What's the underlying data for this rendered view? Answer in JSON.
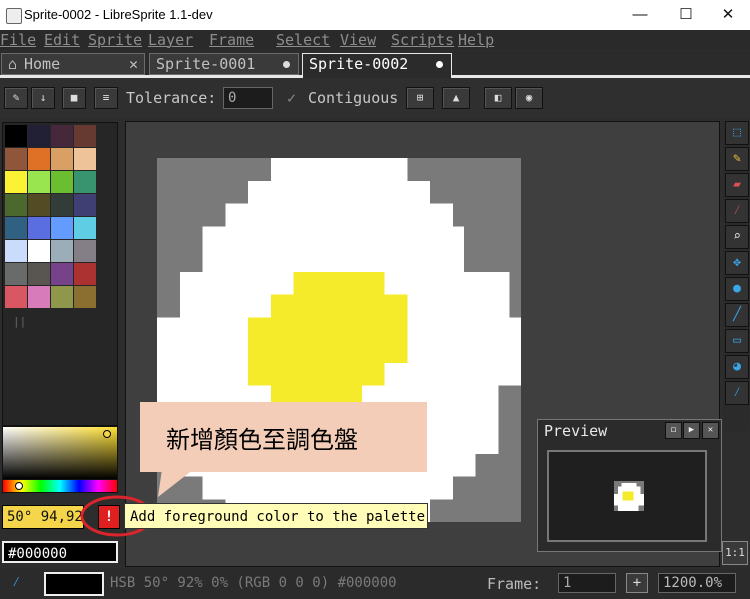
{
  "window": {
    "title": "Sprite-0002 - LibreSprite 1.1-dev",
    "controls": [
      "—",
      "☐",
      "✕"
    ]
  },
  "menu": [
    "File",
    "Edit",
    "Sprite",
    "Layer",
    "Frame",
    "Select",
    "View",
    "Scripts",
    "Help"
  ],
  "tabs": [
    {
      "label": "Home",
      "icon": "home-icon",
      "close": "✕"
    },
    {
      "label": "Sprite-0001"
    },
    {
      "label": "Sprite-0002",
      "active": true
    }
  ],
  "toolbar": {
    "tolerance_label": "Tolerance:",
    "tolerance_value": "0",
    "contiguous_label": "Contiguous",
    "contiguous_checked": true
  },
  "palette": {
    "colors": [
      "#000000",
      "#222034",
      "#45283c",
      "#663931",
      "#8f563b",
      "#df7126",
      "#d9a066",
      "#eec39a",
      "#fbf236",
      "#99e550",
      "#6abe30",
      "#37946e",
      "#4b692f",
      "#524b24",
      "#323c39",
      "#3f3f74",
      "#306082",
      "#5b6ee1",
      "#639bff",
      "#5fcde4",
      "#cbdbfc",
      "#ffffff",
      "#9badb7",
      "#847e87",
      "#696a6a",
      "#595652",
      "#76428a",
      "#ac3232",
      "#d95763",
      "#d77bba",
      "#8f974a",
      "#8a6f30"
    ]
  },
  "color": {
    "fg_hsb": "50° 94,92",
    "hex": "#000000",
    "add_button": "!",
    "tooltip": "Add foreground color to the palette"
  },
  "annotation": {
    "text": "新增顏色至調色盤"
  },
  "preview": {
    "title": "Preview"
  },
  "status": {
    "info": "HSB 50° 92% 0% (RGB 0 0 0) #000000",
    "frame_label": "Frame:",
    "frame_value": "1",
    "add_frame": "+",
    "zoom": "1200.0%",
    "scale_button": "1:1"
  },
  "accent": "#3aa6e8"
}
